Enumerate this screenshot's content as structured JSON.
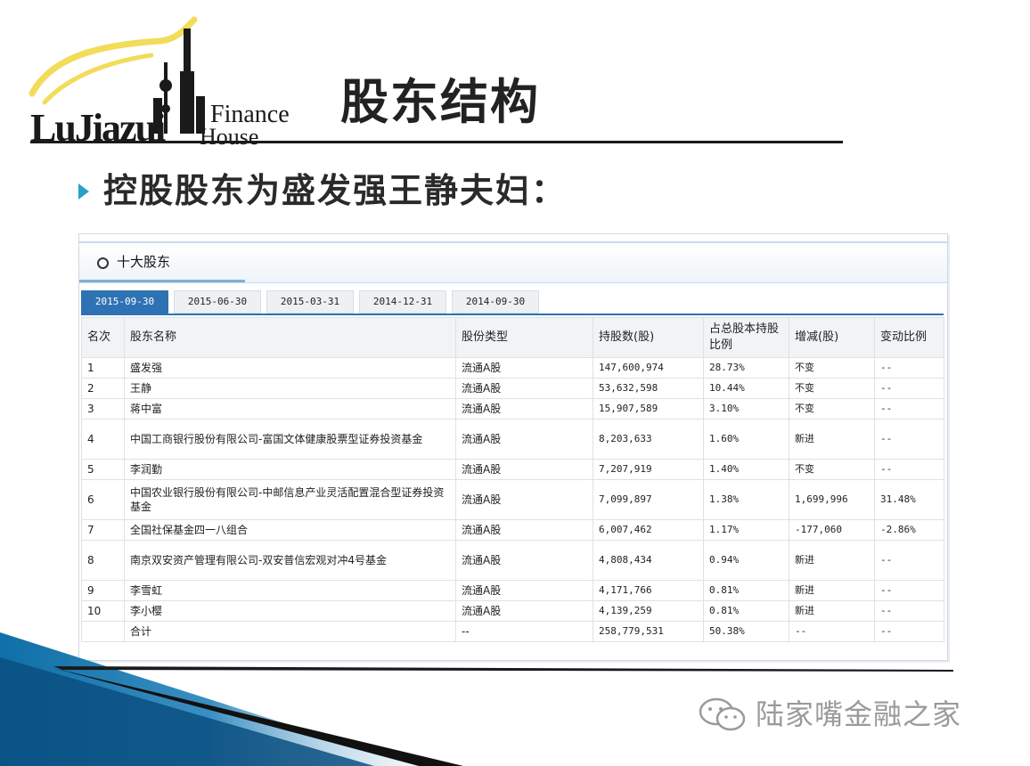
{
  "logo": {
    "word": "LuJiazui",
    "finance": "Finance",
    "house": "House"
  },
  "title": "股东结构",
  "subtitle": "控股股东为盛发强王静夫妇：",
  "panel": {
    "title": "十大股东",
    "tabs": [
      "2015-09-30",
      "2015-06-30",
      "2015-03-31",
      "2014-12-31",
      "2014-09-30"
    ],
    "active_tab": "2015-09-30"
  },
  "table": {
    "headers": [
      "名次",
      "股东名称",
      "股份类型",
      "持股数(股)",
      "占总股本持股比例",
      "增减(股)",
      "变动比例"
    ],
    "rows": [
      [
        "1",
        "盛发强",
        "流通A股",
        "147,600,974",
        "28.73%",
        "不变",
        "--"
      ],
      [
        "2",
        "王静",
        "流通A股",
        "53,632,598",
        "10.44%",
        "不变",
        "--"
      ],
      [
        "3",
        "蒋中富",
        "流通A股",
        "15,907,589",
        "3.10%",
        "不变",
        "--"
      ],
      [
        "4",
        "中国工商银行股份有限公司-富国文体健康股票型证券投资基金",
        "流通A股",
        "8,203,633",
        "1.60%",
        "新进",
        "--"
      ],
      [
        "5",
        "李润勤",
        "流通A股",
        "7,207,919",
        "1.40%",
        "不变",
        "--"
      ],
      [
        "6",
        "中国农业银行股份有限公司-中邮信息产业灵活配置混合型证券投资基金",
        "流通A股",
        "7,099,897",
        "1.38%",
        "1,699,996",
        "31.48%"
      ],
      [
        "7",
        "全国社保基金四一八组合",
        "流通A股",
        "6,007,462",
        "1.17%",
        "-177,060",
        "-2.86%"
      ],
      [
        "8",
        "南京双安资产管理有限公司-双安普信宏观对冲4号基金",
        "流通A股",
        "4,808,434",
        "0.94%",
        "新进",
        "--"
      ],
      [
        "9",
        "李雪虹",
        "流通A股",
        "4,171,766",
        "0.81%",
        "新进",
        "--"
      ],
      [
        "10",
        "李小樱",
        "流通A股",
        "4,139,259",
        "0.81%",
        "新进",
        "--"
      ],
      [
        "",
        "合计",
        "--",
        "258,779,531",
        "50.38%",
        "--",
        "--"
      ]
    ]
  },
  "watermark": {
    "text": "陆家嘴金融之家",
    "icon": "wechat-icon"
  },
  "colors": {
    "accent": "#2f72b4",
    "bullet": "#2aa0c9",
    "logo_arc": "#f2dc59",
    "decor": "#0f6fa8"
  }
}
